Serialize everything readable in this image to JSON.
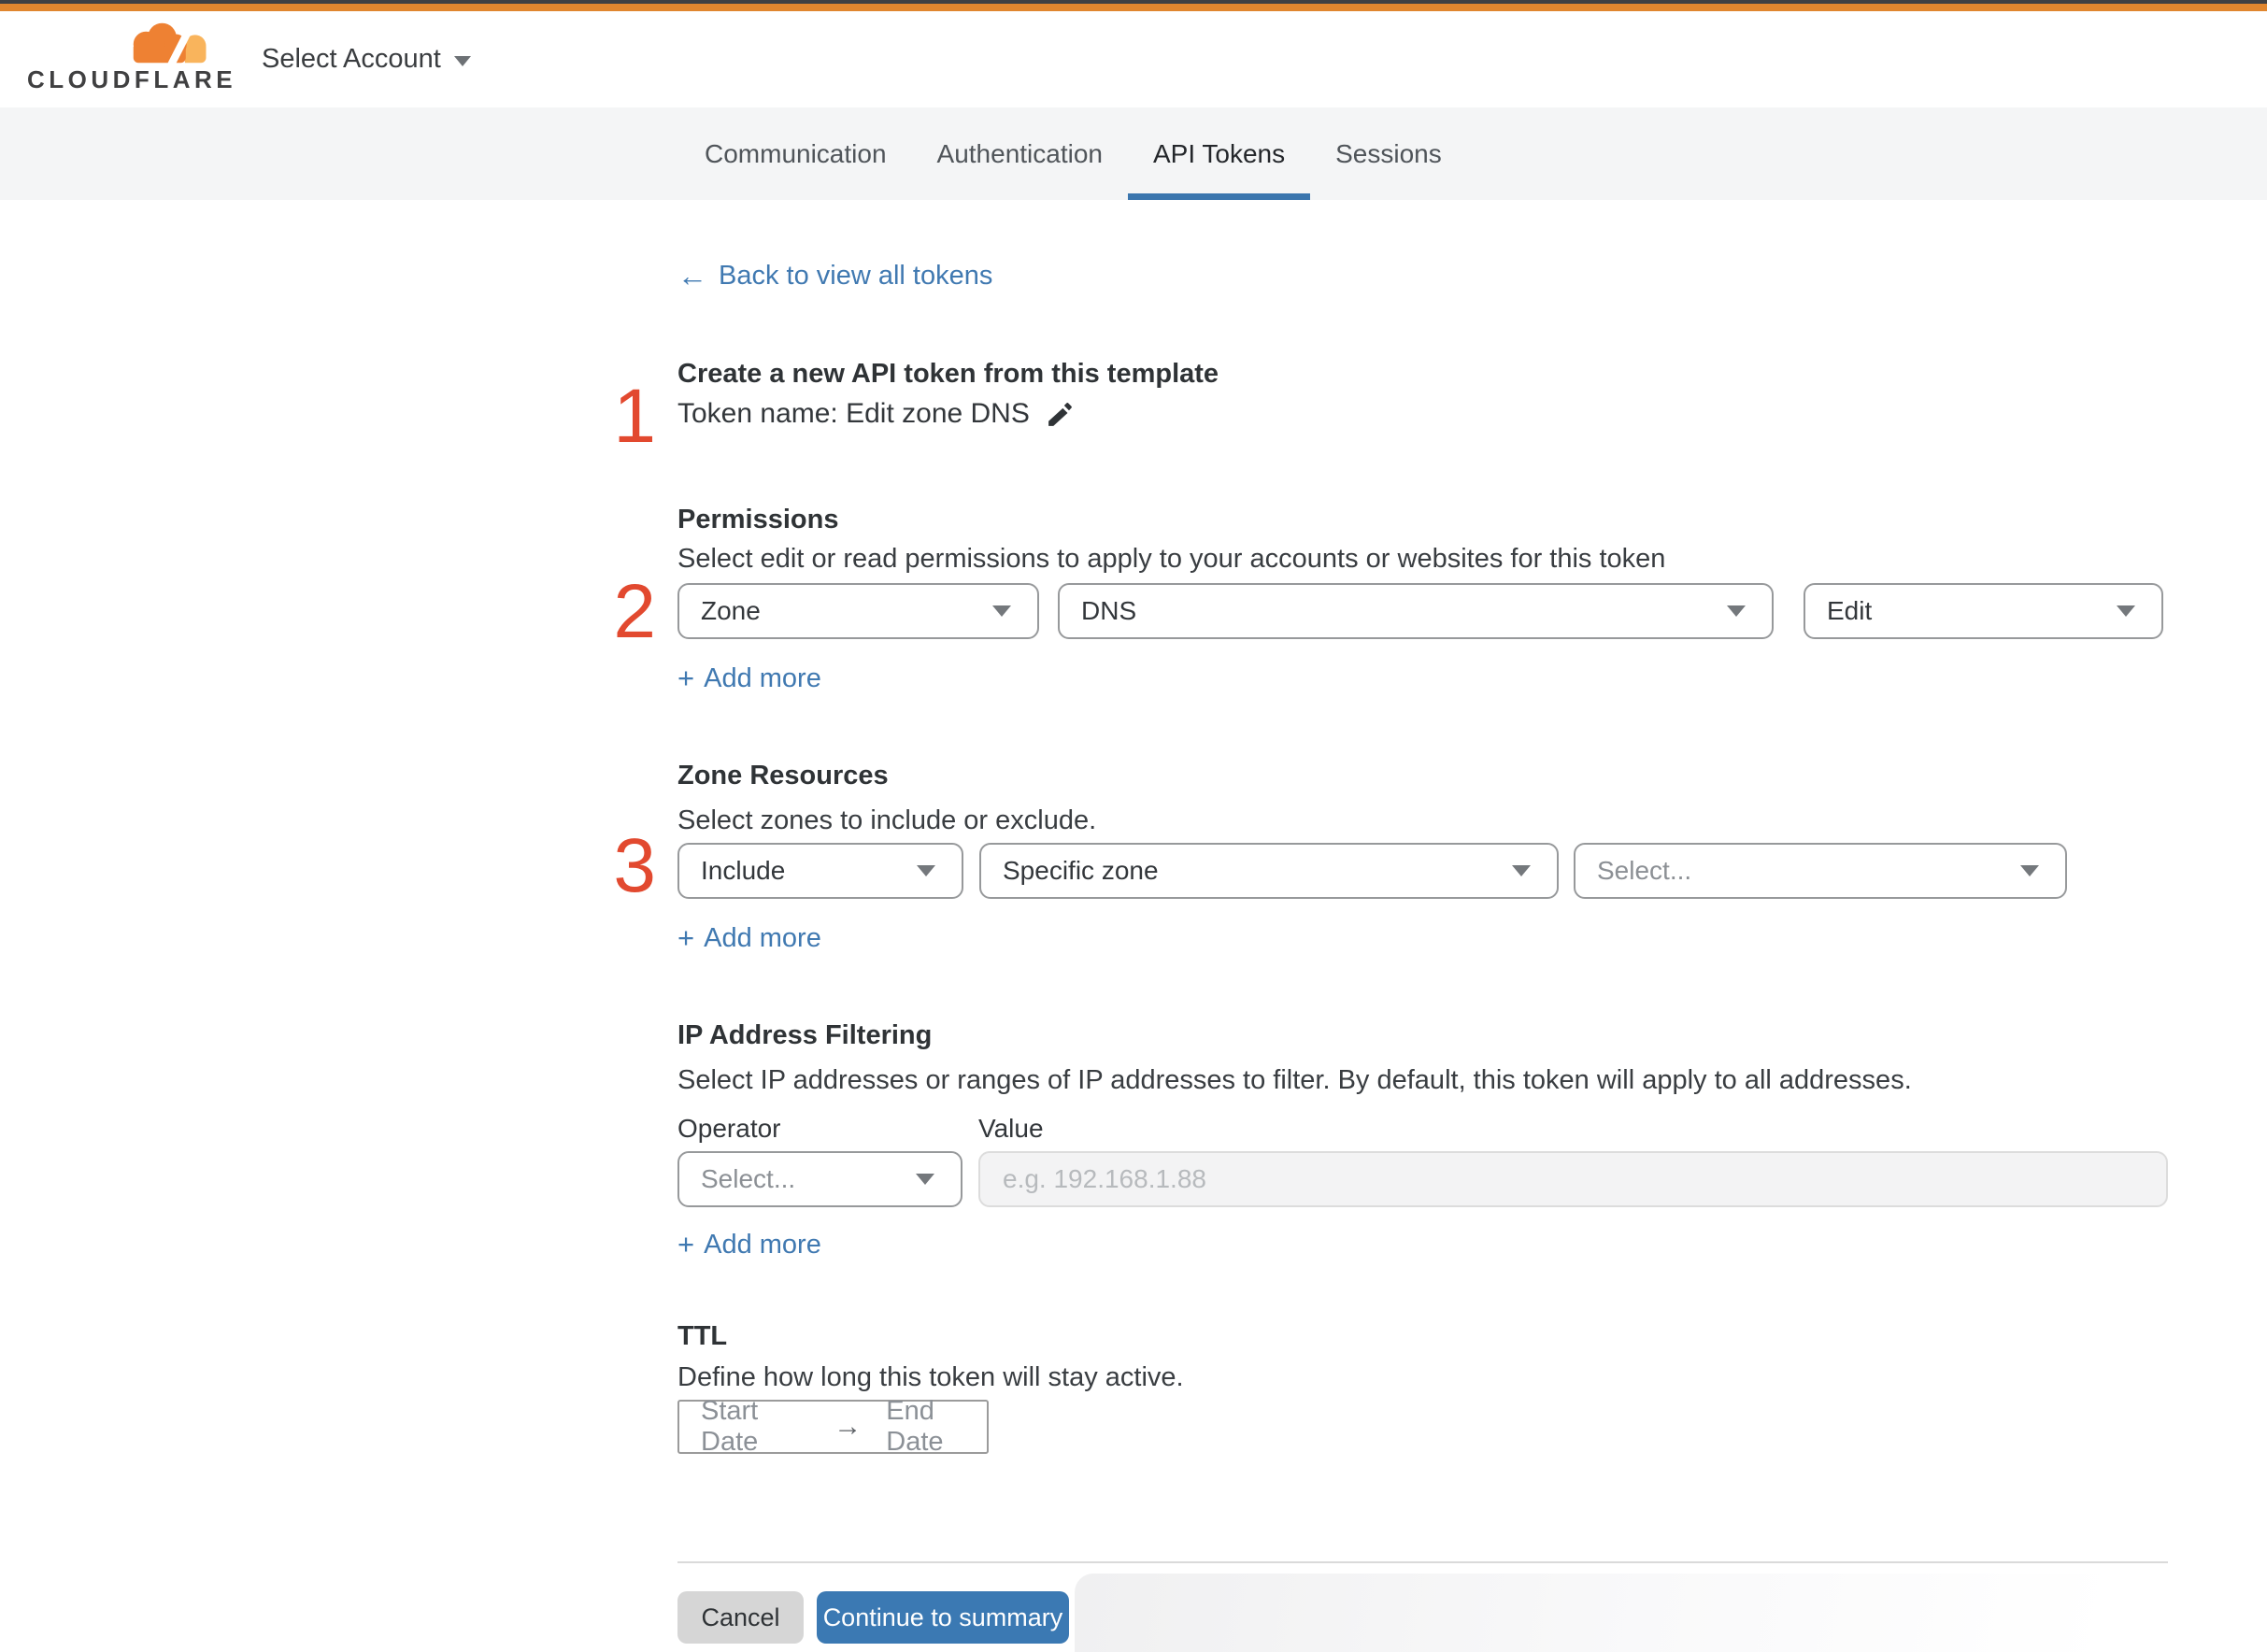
{
  "glyphs": {
    "plus": "+",
    "back_arrow": "←",
    "range_arrow": "→"
  },
  "colors": {
    "brand_orange": "#e0862f",
    "logo_orange": "#ee8133",
    "logo_orange_light": "#f9b45c",
    "accent_blue": "#3b79b3",
    "link_blue": "#4079b1",
    "tab_underline": "#3b76ae",
    "annotation_red": "#e2492f"
  },
  "header": {
    "logo_text": "CLOUDFLARE",
    "account_selector": "Select Account"
  },
  "tabs": [
    {
      "label": "Communication",
      "active": false
    },
    {
      "label": "Authentication",
      "active": false
    },
    {
      "label": "API Tokens",
      "active": true
    },
    {
      "label": "Sessions",
      "active": false
    }
  ],
  "back_link": {
    "label": "Back to view all tokens"
  },
  "annotations": [
    "1",
    "2",
    "3"
  ],
  "form": {
    "title": "Create a new API token from this template",
    "token_name": "Token name: Edit zone DNS",
    "permissions": {
      "heading": "Permissions",
      "description": "Select edit or read permissions to apply to your accounts or websites for this token",
      "selects": [
        "Zone",
        "DNS",
        "Edit"
      ],
      "add_more": "Add more"
    },
    "zone_resources": {
      "heading": "Zone Resources",
      "description": "Select zones to include or exclude.",
      "selects": [
        "Include",
        "Specific zone"
      ],
      "zone_placeholder": "Select...",
      "add_more": "Add more"
    },
    "ip_filtering": {
      "heading": "IP Address Filtering",
      "description": "Select IP addresses or ranges of IP addresses to filter. By default, this token will apply to all addresses.",
      "operator_label": "Operator",
      "value_label": "Value",
      "operator_placeholder": "Select...",
      "value_placeholder": "e.g. 192.168.1.88",
      "add_more": "Add more"
    },
    "ttl": {
      "heading": "TTL",
      "description": "Define how long this token will stay active.",
      "start_date": "Start Date",
      "end_date": "End Date"
    }
  },
  "footer": {
    "cancel_label": "Cancel",
    "continue_label": "Continue to summary"
  }
}
